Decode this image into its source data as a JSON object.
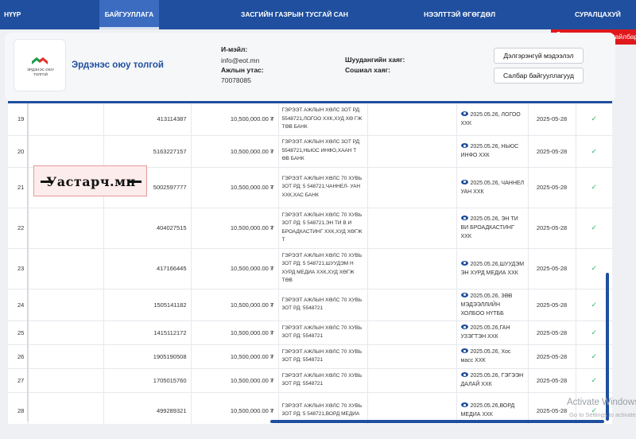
{
  "nav": {
    "items": [
      "НҮҮР",
      "БАЙГУУЛЛАГА",
      "ЗАСГИЙН ГАЗРЫН ТУСГАЙ САН",
      "НЭЭЛТТЭЙ ӨГӨГДӨЛ",
      "СУРАЛЦАХУЙ"
    ],
    "active": "БАЙГУУЛЛАГА",
    "name_change_button": "Нэр томъёоны тайлбар"
  },
  "org": {
    "logo_text": "ЭРДЭНЭС ОЮУ ТОЛГОЙ",
    "name": "Эрдэнэс оюу толгой",
    "email_label": "И-мэйл:",
    "email": "info@eot.mn",
    "phone_label": "Ажлын утас:",
    "phone": "70078085",
    "website_label": "Шуудангийн хаяг:",
    "social_label": "Сошиал хаяг:",
    "detail_button": "Дэлгэрэнгүй мэдээлэл",
    "branch_button": "Салбар байгууллагууд"
  },
  "table": {
    "rows": [
      {
        "no": "19",
        "id": "413114387",
        "amount": "10,500,000.00 ₮",
        "desc": "ГЭРЭЭТ АЖЛЫН ХӨЛС 3ОТ РД: 5548721,ЛОГОО ХХК,ХУД ХӨ ГЖ ТӨВ БАНК",
        "info": "2025.05.26, ЛОГОО ХХК",
        "date": "2025-05-28",
        "check": "✓"
      },
      {
        "no": "20",
        "id": "5163227157",
        "amount": "10,500,000.00 ₮",
        "desc": "ГЭРЭЭТ АЖЛЫН ХӨЛС 3ОТ РД: 5548721,НЬЮС ИНФО,ХААН Т ӨВ БАНК",
        "info": "2025.05.26, НЬЮС ИНФО ХХК",
        "date": "2025-05-28",
        "check": "✓"
      },
      {
        "no": "21",
        "id": "5002597777",
        "amount": "10,500,000.00 ₮",
        "desc": "ГЭРЭЭТ АЖЛЫН ХӨЛС 70 ХУВЬ 3ОТ РД: 5 548721,ЧАННЕЛ- УАН ХХК,ХАС БАНК",
        "info": "2025.05.26, ЧАННЕЛ УАН ХХК",
        "date": "2025-05-28",
        "check": "✓"
      },
      {
        "no": "22",
        "id": "404027515",
        "amount": "10,500,000.00 ₮",
        "desc": "ГЭРЭЭТ АЖЛЫН ХӨЛС 70 ХУВЬ 3ОТ РД: 5 548721,ЭН ТИ В И БРОАДКАСТИНГ ХХК,ХУД ХӨГЖ Т",
        "info": "2025.05.26, ЭН ТИ ВИ БРОАДКАСТИНГ ХХК",
        "date": "2025-05-28",
        "check": "✓"
      },
      {
        "no": "23",
        "id": "417166445",
        "amount": "10,500,000.00 ₮",
        "desc": "ГЭРЭЭТ АЖЛЫН ХӨЛС 70 ХУВЬ 3ОТ РД: 5 548721,ШУУДЭМ Н ХУРД МЕДИА ХХК,ХУД ХӨГЖ ТӨВ",
        "info": "2025.05.26,ШУУДЭМ ЭН ХУРД МЕДИА ХХК",
        "date": "2025-05-28",
        "check": "✓"
      },
      {
        "no": "24",
        "id": "1505141182",
        "amount": "10,500,000.00 ₮",
        "desc": "ГЭРЭЭТ АЖЛЫН ХӨЛС 70 ХУВЬ 3ОТ РД: 5548721",
        "info": "2025.05.26, 3ӨВ МЭДЭЭЛЛИЙН ХОЛБОО НҮТББ",
        "date": "2025-05-28",
        "check": "✓"
      },
      {
        "no": "25",
        "id": "1415112172",
        "amount": "10,500,000.00 ₮",
        "desc": "ГЭРЭЭТ АЖЛЫН ХӨЛС 70 ХУВЬ 3ОТ РД: 5548721",
        "info": "2025.05.26,ГАН УЗЭГТЭН ХХК",
        "date": "2025-05-28",
        "check": "✓"
      },
      {
        "no": "26",
        "id": "1905190508",
        "amount": "10,500,000.00 ₮",
        "desc": "ГЭРЭЭТ АЖЛЫН ХӨЛС 70 ХУВЬ 3ОТ РД: 5548721",
        "info": "2025.05.26, Хос масс ХХК",
        "date": "2025-05-28",
        "check": "✓"
      },
      {
        "no": "27",
        "id": "1705015760",
        "amount": "10,500,000.00 ₮",
        "desc": "ГЭРЭЭТ АЖЛЫН ХӨЛС 70 ХУВЬ 3ОТ РД: 5548721",
        "info": "2025.05.26, ГЭГЭЭН ДАЛАЙ ХХК",
        "date": "2025-05-28",
        "check": "✓"
      },
      {
        "no": "28",
        "id": "499289321",
        "amount": "10,500,000.00 ₮",
        "desc": "ГЭРЭЭТ АЖЛЫН ХӨЛС 70 ХУВЬ 3ОТ РД: 5 548721,ВОРД МЕДИА",
        "info": "2025.05.26,ВОРД МЕДИА ХХК",
        "date": "2025-05-28",
        "check": "✓"
      }
    ]
  },
  "watermark": {
    "text": "Уастарч.мн"
  },
  "os_overlay": {
    "title": "Activate Windows",
    "subtitle": "Go to Settings to activate Windows."
  }
}
